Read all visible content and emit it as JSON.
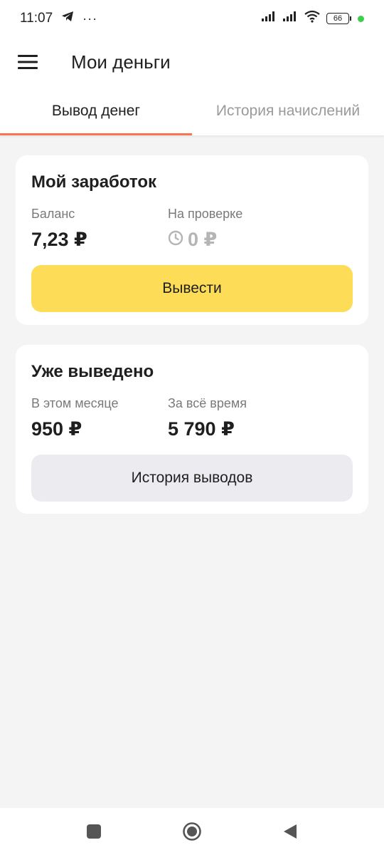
{
  "status_bar": {
    "time": "11:07",
    "battery": "66",
    "icons": [
      "telegram-icon",
      "more-dots-icon",
      "signal-icon",
      "signal-icon",
      "wifi-icon",
      "battery-icon"
    ]
  },
  "app_bar": {
    "title": "Мои деньги",
    "menu_icon": "hamburger-menu-icon"
  },
  "tabs": [
    {
      "label": "Вывод денег",
      "active": true
    },
    {
      "label": "История начислений",
      "active": false
    }
  ],
  "earnings_card": {
    "title": "Мой заработок",
    "balance_label": "Баланс",
    "balance_value": "7,23 ₽",
    "review_label": "На проверке",
    "review_value": "0 ₽",
    "withdraw_button": "Вывести"
  },
  "withdrawn_card": {
    "title": "Уже выведено",
    "month_label": "В этом месяце",
    "month_value": "950 ₽",
    "all_time_label": "За всё время",
    "all_time_value": "5 790 ₽",
    "history_button": "История выводов"
  },
  "colors": {
    "accent_tab": "#fa7450",
    "primary_button": "#fddc57",
    "secondary_button": "#ececf0",
    "background": "#f4f4f4"
  }
}
